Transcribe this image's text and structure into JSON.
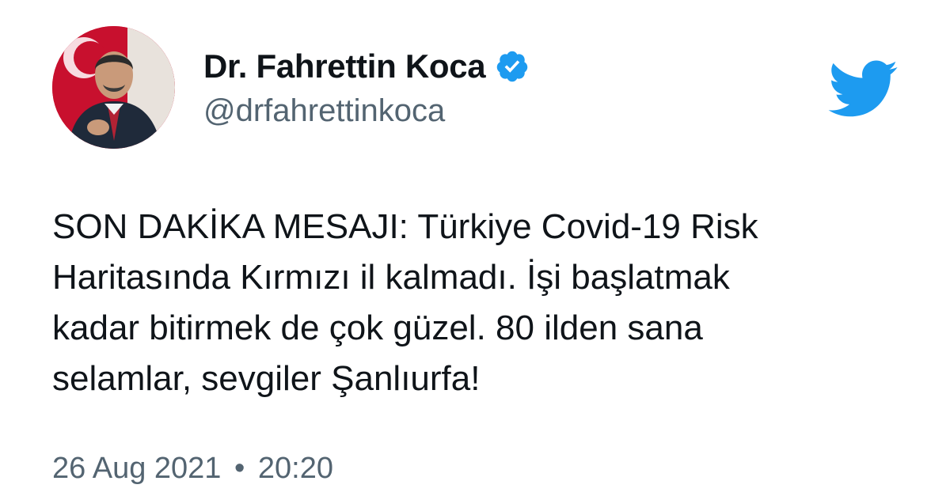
{
  "author": {
    "display_name": "Dr. Fahrettin Koca",
    "handle": "@drfahrettinkoca",
    "verified": true
  },
  "tweet": {
    "text_lines": [
      "SON DAKİKA MESAJI: Türkiye Covid-19 Risk",
      "Haritasında Kırmızı il kalmadı. İşi başlatmak",
      "kadar bitirmek de çok güzel. 80 ilden sana",
      "selamlar, sevgiler Şanlıurfa!"
    ],
    "date": "26 Aug 2021",
    "separator": "•",
    "time": "20:20"
  },
  "icons": {
    "brand": "twitter-bird-icon",
    "verified": "verified-badge-icon"
  },
  "colors": {
    "brand": "#1d9bf0",
    "text": "#0f1419",
    "secondary": "#536471"
  }
}
